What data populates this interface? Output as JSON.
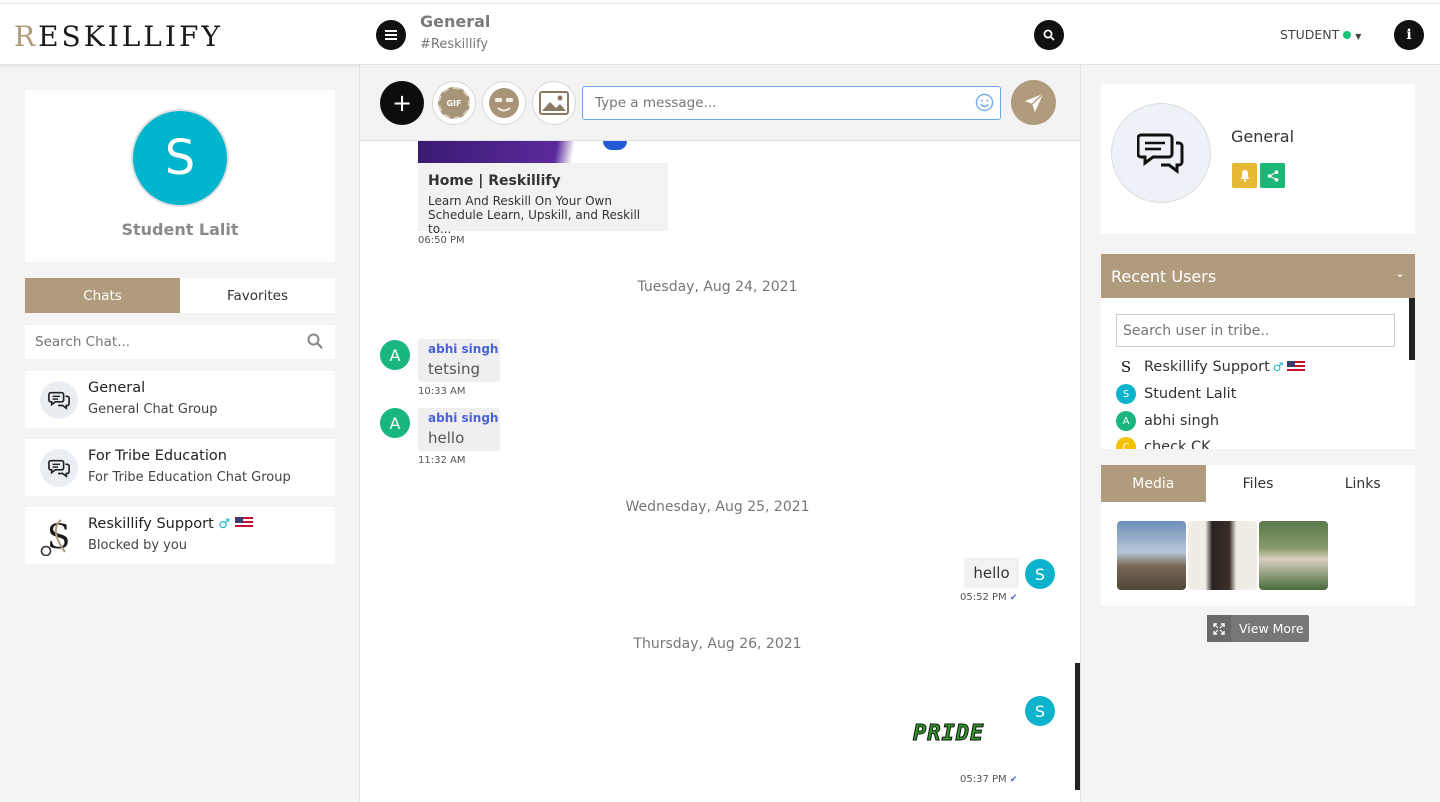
{
  "brand": {
    "logo_r": "R",
    "logo_rest": "ESKILLIFY"
  },
  "profile": {
    "avatar_initial": "S",
    "name": "Student Lalit"
  },
  "left_tabs": {
    "chats": "Chats",
    "favorites": "Favorites"
  },
  "chat_search": {
    "placeholder": "Search Chat..."
  },
  "chat_list": [
    {
      "title": "General",
      "subtitle": "General Chat Group"
    },
    {
      "title": "For Tribe Education",
      "subtitle": "For Tribe Education Chat Group"
    },
    {
      "title": "Reskillify Support",
      "subtitle": "Blocked by you"
    }
  ],
  "header": {
    "channel": "General",
    "channel_tag": "#Reskillify",
    "role": "STUDENT"
  },
  "composer": {
    "placeholder": "Type a message...",
    "gif_label": "GIF"
  },
  "messages": {
    "link_preview": {
      "title": "Home | Reskillify",
      "description": "Learn And Reskill On Your Own Schedule Learn, Upskill, and Reskill to...",
      "time": "06:50 PM"
    },
    "date1": "Tuesday, Aug 24, 2021",
    "msg1": {
      "avatar": "A",
      "sender": "abhi singh",
      "text": "tetsing",
      "time": "10:33 AM"
    },
    "msg2": {
      "avatar": "A",
      "sender": "abhi singh",
      "text": "hello",
      "time": "11:32 AM"
    },
    "date2": "Wednesday, Aug 25, 2021",
    "msg3": {
      "avatar": "S",
      "text": "hello",
      "time": "05:52 PM"
    },
    "date3": "Thursday, Aug 26, 2021",
    "msg4": {
      "avatar": "S",
      "sticker_text": "PRIDE",
      "time": "05:37 PM"
    }
  },
  "group": {
    "name": "General"
  },
  "recent_users": {
    "title": "Recent Users",
    "search_placeholder": "Search user in tribe..",
    "users": [
      {
        "initial": "S",
        "name": "Reskillify Support",
        "color": "#ffffff"
      },
      {
        "initial": "S",
        "name": "Student Lalit",
        "color": "#0db3cc"
      },
      {
        "initial": "A",
        "name": "abhi singh",
        "color": "#19b77d"
      },
      {
        "initial": "C",
        "name": "check CK",
        "color": "#f2c200"
      }
    ]
  },
  "media_tabs": {
    "media": "Media",
    "files": "Files",
    "links": "Links"
  },
  "view_more": "View More",
  "colors": {
    "accent": "#b09b7c",
    "online": "#1cc17a",
    "link_blue": "#4a62d8"
  }
}
